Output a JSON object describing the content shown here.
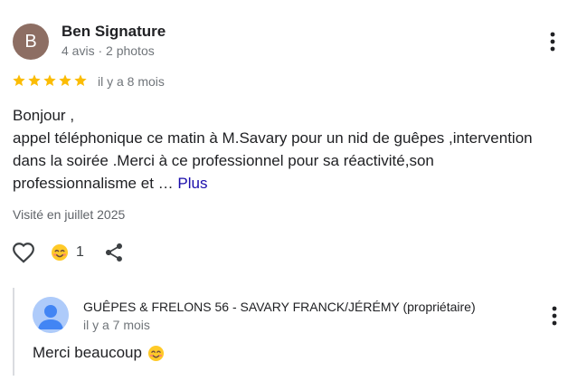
{
  "review": {
    "author": {
      "initial": "B",
      "name": "Ben Signature",
      "meta": "4 avis · 2 photos",
      "avatar_color": "#8d6e63"
    },
    "rating": {
      "value": 5,
      "max": 5,
      "star_color": "#fbbc04"
    },
    "date": "il y a 8 mois",
    "text_lines": [
      "Bonjour ,",
      "appel téléphonique ce matin à M.Savary pour un nid de guêpes ,intervention",
      "dans la soirée .Merci à ce professionnel pour sa réactivité,son",
      "professionnalisme et …"
    ],
    "more_link": "Plus",
    "visited": "Visité en juillet 2025",
    "reaction_count": "1",
    "icons": {
      "more": "more-vert-icon",
      "like": "heart-outline-icon",
      "reaction": "smiling-face-emoji-icon",
      "share": "share-icon"
    }
  },
  "owner_reply": {
    "name": "GUÊPES & FRELONS 56 - SAVARY FRANCK/JÉRÉMY (propriétaire)",
    "date": "il y a 7 mois",
    "text": "Merci beaucoup",
    "avatar_icon": "default-person-avatar-icon",
    "text_emoji": "smiling-face-emoji-icon"
  },
  "colors": {
    "text": "#202124",
    "secondary_text": "#70757a",
    "link": "#1a0dab",
    "reply_border": "#dadce0",
    "owner_avatar_bg": "#aecbfa",
    "owner_avatar_fg": "#4285f4"
  }
}
